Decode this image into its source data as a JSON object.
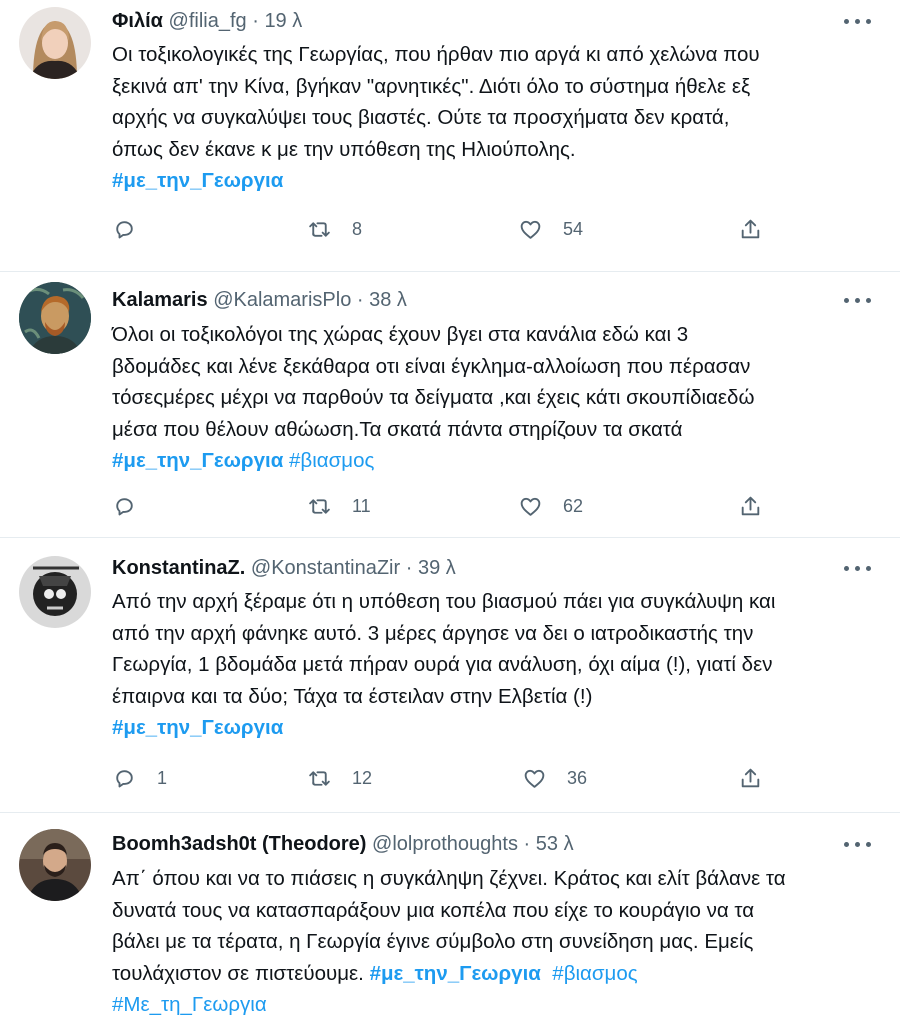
{
  "tweets": [
    {
      "name": "Φιλία",
      "handle": "@filia_fg",
      "time": "19 λ",
      "avatar_icon": "avatar-woman-blonde",
      "text": "Οι τοξικολογικές της Γεωργίας, που ήρθαν πιο αργά κι από χελώνα που\nξεκινά απ' την Κίνα, βγήκαν \"αρνητικές\". Διότι όλο το σύστημα ήθελε εξ\nαρχής να συγκαλύψει τους βιαστές. Ούτε τα προσχήματα δεν κρατά,\nόπως δεν έκανε κ με την υπόθεση της Ηλιούπολης.",
      "hashtags": [
        "#με_την_Γεωργια"
      ],
      "replies": "",
      "retweets": "8",
      "likes": "54"
    },
    {
      "name": "Kalamaris",
      "handle": "@KalamarisPlo",
      "time": "38 λ",
      "avatar_icon": "avatar-van-gogh-portrait",
      "text": "Όλοι οι τοξικολόγοι της χώρας έχουν βγει στα κανάλια εδώ και 3\nβδομάδες και λένε ξεκάθαρα οτι είναι έγκλημα-αλλοίωση που πέρασαν\nτόσεςμέρες μέχρι να παρθούν τα δείγματα ,και έχεις κάτι σκουπίδιαεδώ\nμέσα που θέλουν αθώωση.Τα σκατά πάντα στηρίζουν τα σκατά",
      "hashtags": [
        "#με_την_Γεωργια",
        "#βιασμος"
      ],
      "replies": "",
      "retweets": "11",
      "likes": "62"
    },
    {
      "name": "KonstantinaZ.",
      "handle": "@KonstantinaZir",
      "time": "39 λ",
      "avatar_icon": "avatar-bw-graphic",
      "text": "Από την αρχή ξέραμε ότι η υπόθεση του βιασμού πάει για συγκάλυψη και\nαπό την αρχή φάνηκε αυτό. 3 μέρες άργησε να δει ο ιατροδικαστής την\nΓεωργία, 1 βδομάδα μετά πήραν ουρά για ανάλυση, όχι αίμα (!), γιατί δεν\nέπαιρνα και τα δύο; Τάχα τα έστειλαν στην Ελβετία (!)",
      "hashtags": [
        "#με_την_Γεωργια"
      ],
      "replies": "1",
      "retweets": "12",
      "likes": "36"
    },
    {
      "name": "Boomh3adsh0t (Theodore)",
      "handle": "@lolprothoughts",
      "time": "53 λ",
      "avatar_icon": "avatar-man-bearded",
      "text": "Απ΄ όπου και να το πιάσεις η συγκάληψη ζέχνει. Κράτος και ελίτ βάλανε τα\nδυνατά τους να κατασπαράξουν μια κοπέλα που είχε το κουράγιο να τα\nβάλει με τα τέρατα, η Γεωργία έγινε σύμβολο στη συνείδηση μας. Εμείς\nτουλάχιστον σε πιστεύουμε. ",
      "hashtags_inline": [
        "#με_την_Γεωργια",
        "#βιασμος"
      ],
      "hashtags": [
        "#Με_τη_Γεωργια"
      ]
    }
  ],
  "colors": {
    "link": "#1d9bf0",
    "secondary_text": "#536471",
    "divider": "#e6ecf0"
  }
}
